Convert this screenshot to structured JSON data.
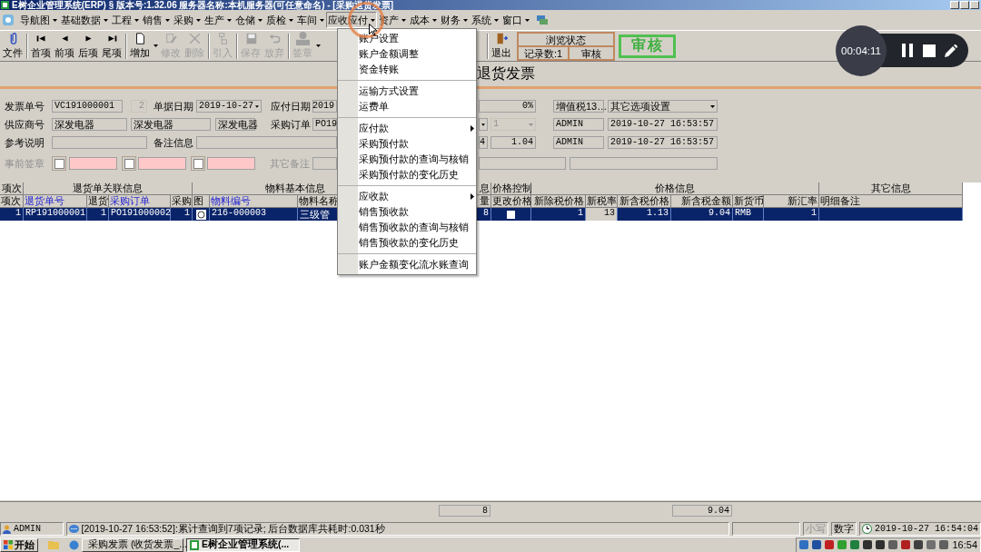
{
  "title_bar": {
    "title": "E树企业管理系统(ERP) § 版本号:1.32.06  服务器名称:本机服务器(可任意命名) - [采购退货发票]"
  },
  "menu_bar": [
    {
      "label": "导航图",
      "selected": false
    },
    {
      "label": "基础数据",
      "selected": false
    },
    {
      "label": "工程",
      "selected": false
    },
    {
      "label": "销售",
      "selected": false
    },
    {
      "label": "采购",
      "selected": false
    },
    {
      "label": "生产",
      "selected": false
    },
    {
      "label": "仓储",
      "selected": false
    },
    {
      "label": "质检",
      "selected": false
    },
    {
      "label": "车间",
      "selected": false
    },
    {
      "label": "应收应付",
      "selected": true
    },
    {
      "label": "资产",
      "selected": false
    },
    {
      "label": "成本",
      "selected": false
    },
    {
      "label": "财务",
      "selected": false
    },
    {
      "label": "系统",
      "selected": false
    },
    {
      "label": "窗口",
      "selected": false
    }
  ],
  "dropdown": {
    "sections": [
      {
        "items": [
          {
            "label": "账户设置",
            "submenu": false
          },
          {
            "label": "账户金额调整",
            "submenu": false
          },
          {
            "label": "资金转账",
            "submenu": false
          }
        ]
      },
      {
        "items": [
          {
            "label": "运输方式设置",
            "submenu": false
          },
          {
            "label": "运费单",
            "submenu": false
          }
        ]
      },
      {
        "items": [
          {
            "label": "应付款",
            "submenu": true
          },
          {
            "label": "采购预付款",
            "submenu": false
          },
          {
            "label": "采购预付款的查询与核销",
            "submenu": false
          },
          {
            "label": "采购预付款的变化历史",
            "submenu": false
          }
        ]
      },
      {
        "items": [
          {
            "label": "应收款",
            "submenu": true
          },
          {
            "label": "销售预收款",
            "submenu": false
          },
          {
            "label": "销售预收款的查询与核销",
            "submenu": false
          },
          {
            "label": "销售预收款的变化历史",
            "submenu": false
          }
        ]
      },
      {
        "items": [
          {
            "label": "账户金额变化流水账查询",
            "submenu": false
          }
        ]
      }
    ]
  },
  "toolbar": [
    {
      "label": "文件",
      "kind": "clip",
      "disabled": false,
      "has_menu": false
    },
    {
      "label": "首项",
      "kind": "first",
      "disabled": false,
      "has_menu": false
    },
    {
      "label": "前项",
      "kind": "prev",
      "disabled": false,
      "has_menu": false
    },
    {
      "label": "后项",
      "kind": "next",
      "disabled": false,
      "has_menu": false
    },
    {
      "label": "尾项",
      "kind": "last",
      "disabled": false,
      "has_menu": false
    },
    {
      "label": "增加",
      "kind": "new",
      "disabled": false,
      "has_menu": true
    },
    {
      "label": "修改",
      "kind": "edit",
      "disabled": true,
      "has_menu": false
    },
    {
      "label": "删除",
      "kind": "delete",
      "disabled": true,
      "has_menu": false
    },
    {
      "label": "引入",
      "kind": "import",
      "disabled": true,
      "has_menu": false
    },
    {
      "label": "保存",
      "kind": "save",
      "disabled": true,
      "has_menu": false
    },
    {
      "label": "放弃",
      "kind": "undo",
      "disabled": true,
      "has_menu": false
    },
    {
      "label": "签章",
      "kind": "stamp",
      "disabled": true,
      "has_menu": true
    },
    {
      "label": "退出",
      "kind": "exit",
      "disabled": false,
      "has_menu": false
    }
  ],
  "status_box": {
    "title": "浏览状态",
    "records": "记录数:1",
    "state": "审核"
  },
  "stamp": "审核",
  "document_title": "退货发票",
  "form": {
    "rows": [
      {
        "items": [
          {
            "kind": "label",
            "text": "发票单号",
            "disabled": false
          },
          {
            "kind": "field",
            "text": "VC191000001",
            "disabled": false
          },
          {
            "kind": "field",
            "text": "2",
            "disabled": true
          },
          {
            "kind": "label",
            "text": "单据日期",
            "disabled": false
          },
          {
            "kind": "dropdown",
            "text": "2019-10-27",
            "disabled": false
          },
          {
            "kind": "label",
            "text": "应付日期",
            "disabled": false
          },
          {
            "kind": "field",
            "text": "2019",
            "disabled": false
          },
          {
            "kind": "field",
            "text": "0%",
            "disabled": false
          },
          {
            "kind": "field",
            "text": "增值税13…",
            "disabled": false
          },
          {
            "kind": "dropdown",
            "text": "其它选项设置",
            "disabled": false
          }
        ]
      },
      {
        "items": [
          {
            "kind": "label",
            "text": "供应商号",
            "disabled": false
          },
          {
            "kind": "field",
            "text": "深发电器",
            "disabled": false
          },
          {
            "kind": "field",
            "text": "深发电器",
            "disabled": false
          },
          {
            "kind": "field",
            "text": "深发电器",
            "disabled": false
          },
          {
            "kind": "label",
            "text": "采购订单",
            "disabled": false
          },
          {
            "kind": "field",
            "text": "PO19",
            "disabled": false
          },
          {
            "kind": "dropdown",
            "disabled": false
          },
          {
            "kind": "dropdown",
            "text": "1",
            "disabled": true
          },
          {
            "kind": "field",
            "text": "ADMIN",
            "disabled": false
          },
          {
            "kind": "field",
            "text": "2019-10-27 16:53:57",
            "disabled": false
          }
        ]
      },
      {
        "items": [
          {
            "kind": "label",
            "text": "参考说明",
            "disabled": false
          },
          {
            "kind": "field",
            "disabled": false
          },
          {
            "kind": "label",
            "text": "备注信息",
            "disabled": false
          },
          {
            "kind": "field",
            "disabled": false
          },
          {
            "kind": "field",
            "text": "4",
            "disabled": false
          },
          {
            "kind": "field",
            "text": "1.04",
            "disabled": false
          },
          {
            "kind": "field",
            "text": "ADMIN",
            "disabled": false
          },
          {
            "kind": "field",
            "text": "2019-10-27 16:53:57",
            "disabled": false
          }
        ]
      },
      {
        "items": [
          {
            "kind": "label",
            "text": "事前签章",
            "disabled": true
          },
          {
            "kind": "check",
            "checked": false,
            "disabled": false
          },
          {
            "kind": "signature",
            "disabled": false
          },
          {
            "kind": "check",
            "checked": false,
            "disabled": false
          },
          {
            "kind": "signature",
            "disabled": false
          },
          {
            "kind": "check",
            "checked": false,
            "disabled": false
          },
          {
            "kind": "signature",
            "disabled": false
          },
          {
            "kind": "label",
            "text": "其它备注",
            "disabled": true
          },
          {
            "kind": "field",
            "disabled": false
          },
          {
            "kind": "field",
            "disabled": false
          },
          {
            "kind": "field",
            "disabled": false
          }
        ]
      }
    ]
  },
  "table": {
    "groups": [
      "项次",
      "退货单关联信息",
      "物料基本信息",
      "息",
      "价格控制",
      "价格信息",
      "其它信息"
    ],
    "columns": [
      {
        "label": "项次",
        "link": false,
        "locked": false
      },
      {
        "label": "退货单号",
        "link": true,
        "locked": false
      },
      {
        "label": "退货",
        "link": false,
        "locked": false
      },
      {
        "label": "采购订单",
        "link": true,
        "locked": false
      },
      {
        "label": "采购",
        "link": false,
        "locked": false
      },
      {
        "label": "图",
        "link": false,
        "locked": false
      },
      {
        "label": "物料编号",
        "link": true,
        "locked": false
      },
      {
        "label": "物料名称",
        "link": false,
        "locked": false
      },
      {
        "label": "量",
        "link": false,
        "locked": false
      },
      {
        "label": "更改价格",
        "link": false,
        "locked": false
      },
      {
        "label": "新除税价格",
        "link": false,
        "locked": false
      },
      {
        "label": "新税率",
        "link": false,
        "locked": true
      },
      {
        "label": "新含税价格",
        "link": false,
        "locked": false
      },
      {
        "label": "新含税金额",
        "link": false,
        "locked": false
      },
      {
        "label": "新货币",
        "link": false,
        "locked": false
      },
      {
        "label": "新汇率",
        "link": false,
        "locked": false
      },
      {
        "label": "明细备注",
        "link": false,
        "locked": false
      }
    ],
    "rows": [
      {
        "selected": true,
        "cells": [
          {
            "kind": "text",
            "text": "1"
          },
          {
            "kind": "text",
            "text": "RP191000001"
          },
          {
            "kind": "text",
            "text": "1"
          },
          {
            "kind": "text",
            "text": "PO191000002"
          },
          {
            "kind": "text",
            "text": "1"
          },
          {
            "kind": "image"
          },
          {
            "kind": "text",
            "text": "216-000003"
          },
          {
            "kind": "text",
            "text": "三级管"
          },
          {
            "kind": "text",
            "text": "8"
          },
          {
            "kind": "check",
            "checked": false
          },
          {
            "kind": "text",
            "text": "1"
          },
          {
            "kind": "text",
            "text": "13"
          },
          {
            "kind": "text",
            "text": "1.13"
          },
          {
            "kind": "text",
            "text": "9.04"
          },
          {
            "kind": "text",
            "text": "RMB"
          },
          {
            "kind": "text",
            "text": "1"
          }
        ]
      }
    ]
  },
  "totals": [
    {
      "text": "8"
    },
    {
      "text": "9.04"
    }
  ],
  "status_bar": {
    "user": "ADMIN",
    "message": "[2019-10-27 16:53:52]:累计查询到7项记录; 后台数据库共耗时:0.031秒",
    "indicators": [
      {
        "label": "小写",
        "active": false
      },
      {
        "label": "数字",
        "active": true
      }
    ],
    "clock": "2019-10-27 16:54:04"
  },
  "taskbar": {
    "start": "开始",
    "tasks": [
      {
        "label": "采购发票 (收货发票_...",
        "selected": false,
        "kind": "word"
      },
      {
        "label": "E树企业管理系统(...",
        "selected": true,
        "kind": "app"
      }
    ],
    "time": "16:54"
  },
  "recorder": {
    "time": "00:04:11"
  }
}
